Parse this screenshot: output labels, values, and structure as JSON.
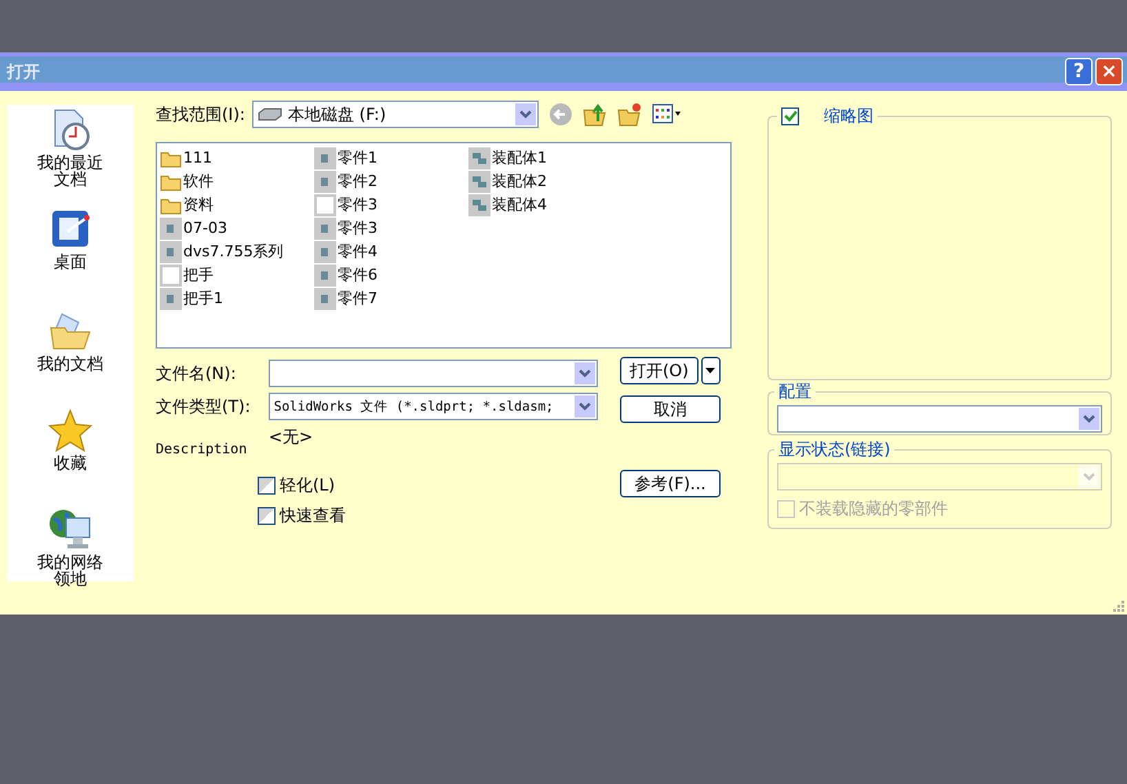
{
  "window": {
    "title": "打开",
    "help": "?",
    "close": "×"
  },
  "places": [
    {
      "label": "我的最近文档",
      "kind": "recent"
    },
    {
      "label": "桌面",
      "kind": "desktop"
    },
    {
      "label": "我的文档",
      "kind": "documents"
    },
    {
      "label": "收藏",
      "kind": "favorites"
    },
    {
      "label": "我的网络领地",
      "kind": "network"
    }
  ],
  "look_in": {
    "label": "查找范围(I):",
    "value": "本地磁盘 (F:)"
  },
  "files": [
    {
      "name": "111",
      "kind": "folder"
    },
    {
      "name": "软件",
      "kind": "folder"
    },
    {
      "name": "资料",
      "kind": "folder"
    },
    {
      "name": "07-03",
      "kind": "part"
    },
    {
      "name": "dvs7.755系列",
      "kind": "part"
    },
    {
      "name": "把手",
      "kind": "blank"
    },
    {
      "name": "把手1",
      "kind": "part"
    },
    {
      "name": "零件1",
      "kind": "part"
    },
    {
      "name": "零件2",
      "kind": "part"
    },
    {
      "name": "零件3",
      "kind": "blank"
    },
    {
      "name": "零件3",
      "kind": "part"
    },
    {
      "name": "零件4",
      "kind": "part"
    },
    {
      "name": "零件6",
      "kind": "part"
    },
    {
      "name": "零件7",
      "kind": "part"
    },
    {
      "name": "装配体1",
      "kind": "assembly"
    },
    {
      "name": "装配体2",
      "kind": "assembly"
    },
    {
      "name": "装配体4",
      "kind": "assembly"
    }
  ],
  "file_name": {
    "label": "文件名(N):"
  },
  "file_type": {
    "label": "文件类型(T):",
    "value": "SolidWorks 文件 (*.sldprt; *.sldasm;"
  },
  "description": {
    "label": "Description",
    "value": "<无>"
  },
  "options": [
    {
      "label": "轻化(L)",
      "checked": false
    },
    {
      "label": "快速查看",
      "checked": false
    }
  ],
  "buttons": {
    "open": "打开(O)",
    "cancel": "取消",
    "reference": "参考(F)..."
  },
  "thumbnail": {
    "label": "缩略图",
    "checked": true
  },
  "configuration": {
    "label": "配置"
  },
  "display_state": {
    "label": "显示状态(链接)",
    "disabled": true
  },
  "hide_option": {
    "label": "不装载隐藏的零部件",
    "checked": false,
    "disabled": true
  }
}
